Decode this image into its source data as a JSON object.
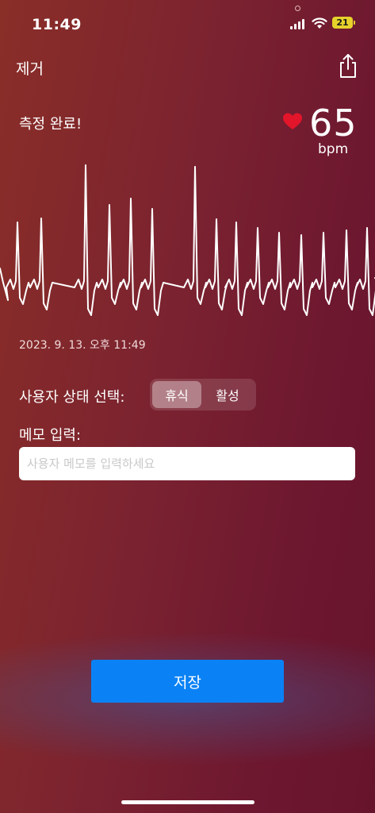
{
  "status_bar": {
    "time": "11:49",
    "battery_level": "21",
    "icons": [
      "signal-icon",
      "wifi-icon",
      "battery-icon"
    ]
  },
  "nav": {
    "remove_label": "제거",
    "share_icon": "share-icon"
  },
  "measurement": {
    "status_text": "측정 완료!",
    "heart_icon": "heart-icon",
    "heart_color": "#e3152a",
    "bpm_value": "65",
    "bpm_unit": "bpm",
    "timestamp": "2023. 9. 13. 오후 11:49"
  },
  "user_state": {
    "label": "사용자 상태 선택:",
    "options": [
      "휴식",
      "활성"
    ],
    "selected": "휴식"
  },
  "memo": {
    "label": "메모 입력:",
    "value": "",
    "placeholder": "사용자 메모를 입력하세요"
  },
  "save_label": "저장",
  "colors": {
    "accent": "#0a82f5",
    "background_start": "#8a2e28",
    "background_end": "#66142c"
  }
}
